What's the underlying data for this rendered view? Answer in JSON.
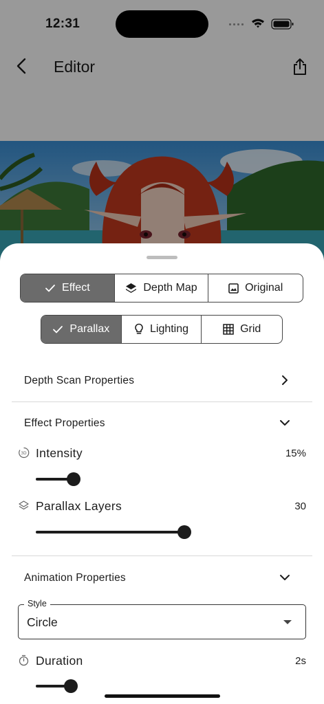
{
  "status_bar": {
    "time": "12:31"
  },
  "app_bar": {
    "title": "Editor"
  },
  "mode_tabs": [
    {
      "label": "Effect",
      "icon": "check-icon",
      "selected": true
    },
    {
      "label": "Depth Map",
      "icon": "layers-icon",
      "selected": false
    },
    {
      "label": "Original",
      "icon": "image-icon",
      "selected": false
    }
  ],
  "effect_tabs": [
    {
      "label": "Parallax",
      "icon": "check-icon",
      "selected": true
    },
    {
      "label": "Lighting",
      "icon": "lightbulb-icon",
      "selected": false
    },
    {
      "label": "Grid",
      "icon": "grid-icon",
      "selected": false
    }
  ],
  "sections": {
    "depth_scan": {
      "label": "Depth Scan Properties",
      "expanded": false
    },
    "effect": {
      "label": "Effect Properties",
      "expanded": true
    },
    "animation": {
      "label": "Animation Properties",
      "expanded": true
    }
  },
  "effect_properties": {
    "intensity": {
      "label": "Intensity",
      "value_text": "15%",
      "fraction": 0.25,
      "icon": "3d-rotate-icon"
    },
    "parallax_layers": {
      "label": "Parallax Layers",
      "value_text": "30",
      "fraction": 0.93,
      "icon": "layers-outline-icon"
    }
  },
  "animation_properties": {
    "style": {
      "label": "Style",
      "value": "Circle"
    },
    "duration": {
      "label": "Duration",
      "value_text": "2s",
      "fraction": 0.17,
      "icon": "timer-icon"
    }
  },
  "colors": {
    "selected_segment": "#6b6b6b",
    "slider": "#1c1c1c",
    "scrim": "rgba(0,0,0,0.4)"
  }
}
